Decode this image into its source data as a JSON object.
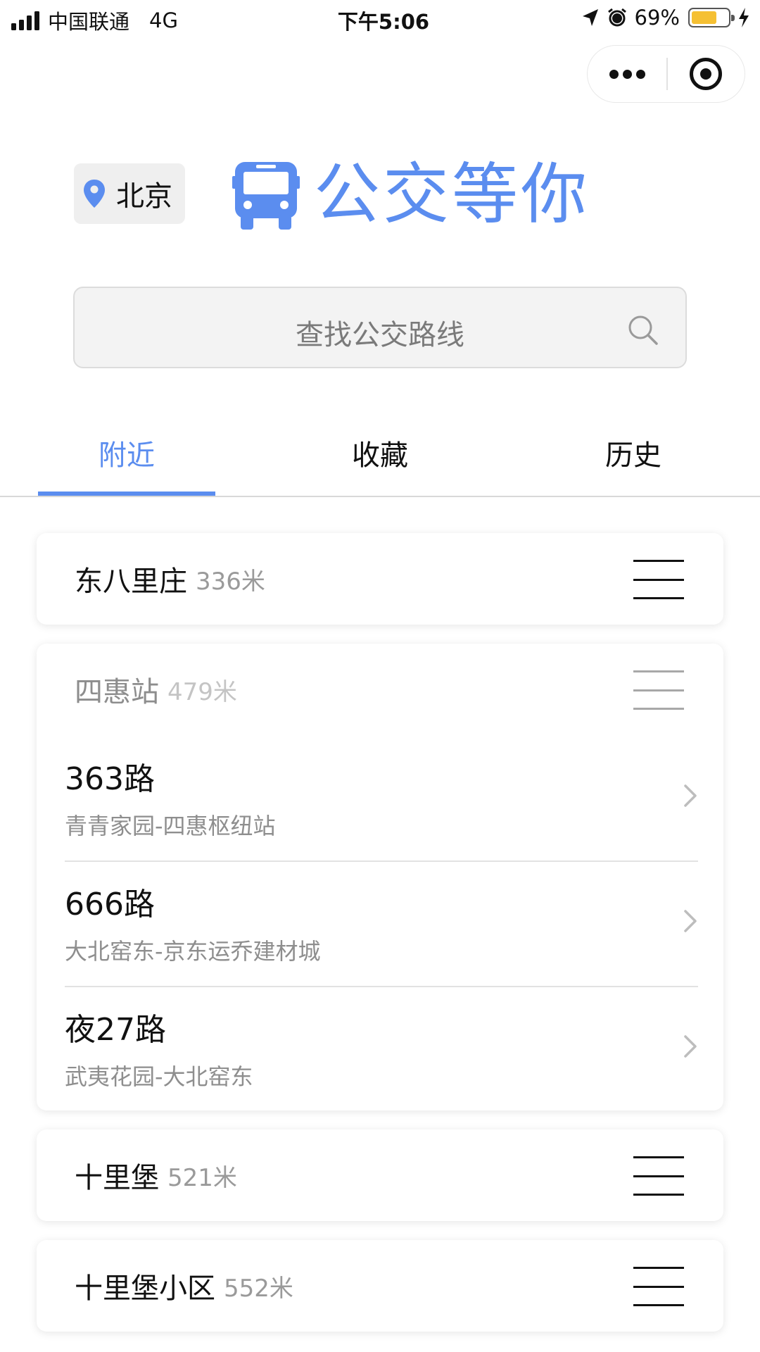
{
  "status_bar": {
    "carrier": "中国联通",
    "network": "4G",
    "time": "下午5:06",
    "battery": "69%",
    "battery_level": 0.69
  },
  "header": {
    "city": "北京",
    "app_title": "公交等你"
  },
  "search": {
    "placeholder": "查找公交路线"
  },
  "tabs": [
    {
      "label": "附近",
      "active": true
    },
    {
      "label": "收藏",
      "active": false
    },
    {
      "label": "历史",
      "active": false
    }
  ],
  "stops": [
    {
      "name": "东八里庄",
      "distance": "336米"
    },
    {
      "name": "四惠站",
      "distance": "479米",
      "routes": [
        {
          "name": "363路",
          "direction": "青青家园-四惠枢纽站"
        },
        {
          "name": "666路",
          "direction": "大北窑东-京东运乔建材城"
        },
        {
          "name": "夜27路",
          "direction": "武夷花园-大北窑东"
        }
      ]
    },
    {
      "name": "十里堡",
      "distance": "521米"
    },
    {
      "name": "十里堡小区",
      "distance": "552米"
    }
  ],
  "colors": {
    "accent": "#5b8def",
    "battery": "#f5c033"
  }
}
